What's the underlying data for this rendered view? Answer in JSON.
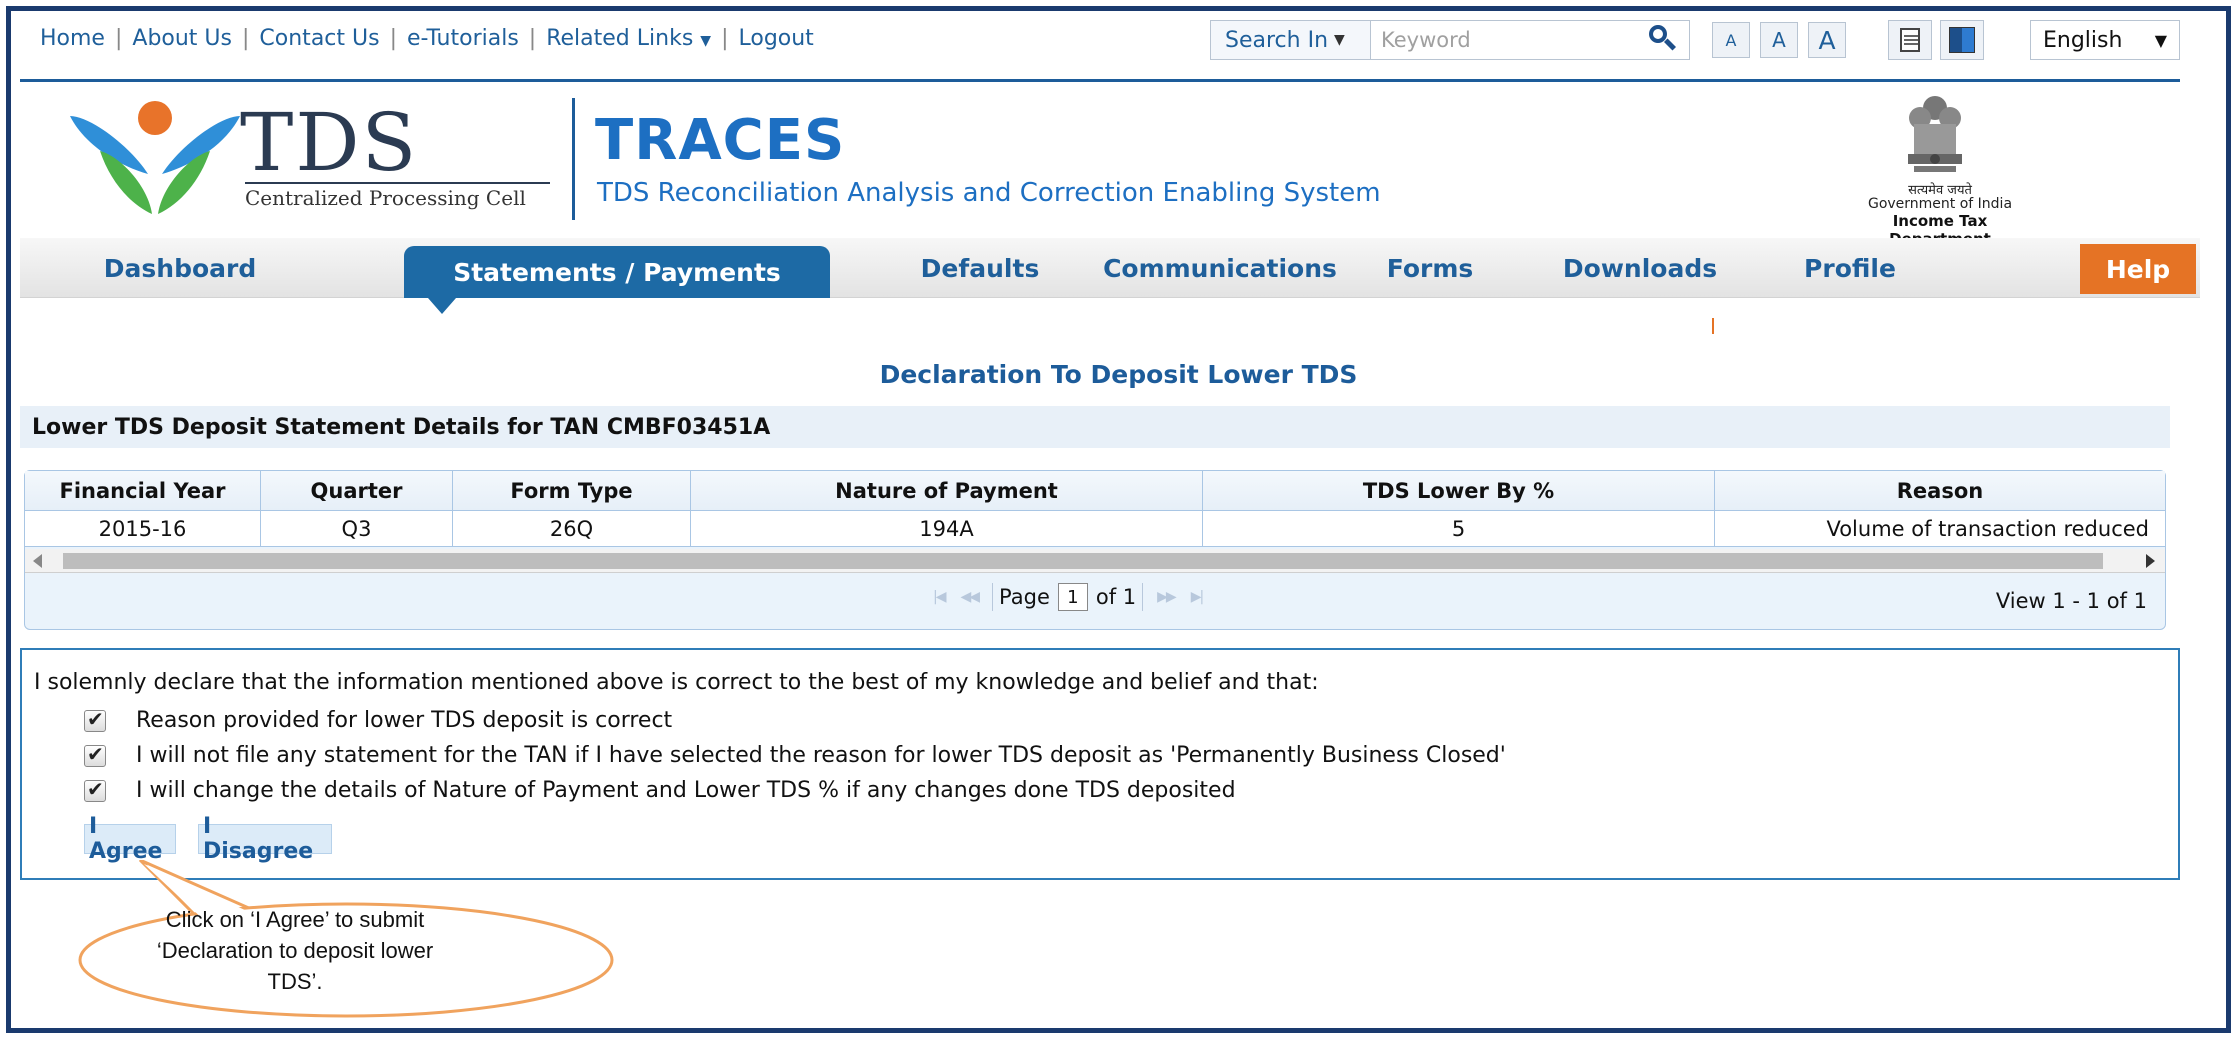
{
  "topnav": {
    "links": [
      "Home",
      "About Us",
      "Contact Us",
      "e-Tutorials",
      "Related Links",
      "Logout"
    ],
    "search_in": "Search In",
    "search_placeholder": "Keyword",
    "font_sizes": [
      "A",
      "A",
      "A"
    ],
    "language": "English"
  },
  "header": {
    "logo_word": "TDS",
    "logo_sub": "Centralized Processing Cell",
    "app_name": "TRACES",
    "app_full": "TDS Reconciliation Analysis and Correction Enabling System",
    "emblem_motto": "सत्यमेव जयते",
    "gov_line": "Government of India",
    "dept_line": "Income Tax Department"
  },
  "nav": {
    "items": [
      "Dashboard",
      "Statements / Payments",
      "Defaults",
      "Communications",
      "Forms",
      "Downloads",
      "Profile",
      "Help"
    ],
    "active": "Statements / Payments"
  },
  "page": {
    "title": "Declaration To Deposit Lower TDS",
    "section_title": "Lower TDS Deposit Statement Details for TAN CMBF03451A"
  },
  "grid": {
    "columns": [
      "Financial Year",
      "Quarter",
      "Form Type",
      "Nature of Payment",
      "TDS Lower By %",
      "Reason"
    ],
    "rows": [
      [
        "2015-16",
        "Q3",
        "26Q",
        "194A",
        "5",
        "Volume of transaction reduced"
      ]
    ],
    "pager": {
      "page_label": "Page",
      "page_value": "1",
      "of_label": "of 1",
      "view_text": "View 1 - 1 of 1"
    }
  },
  "declaration": {
    "intro": "I solemnly declare that the information mentioned above is correct to the best of my knowledge and belief and that:",
    "items": [
      "Reason provided for lower TDS deposit is correct",
      "I will not file any statement for the TAN if I have selected the reason for lower TDS deposit as 'Permanently Business Closed'",
      "I will change the details of Nature of Payment and Lower TDS % if any changes done TDS deposited"
    ],
    "agree_label": "I Agree",
    "disagree_label": "I Disagree"
  },
  "callout": {
    "text": "Click on ‘I Agree’ to submit ‘Declaration to deposit lower TDS’."
  },
  "colors": {
    "primary": "#1d6aa5",
    "help": "#e57325",
    "callout_border": "#f0a35e"
  }
}
